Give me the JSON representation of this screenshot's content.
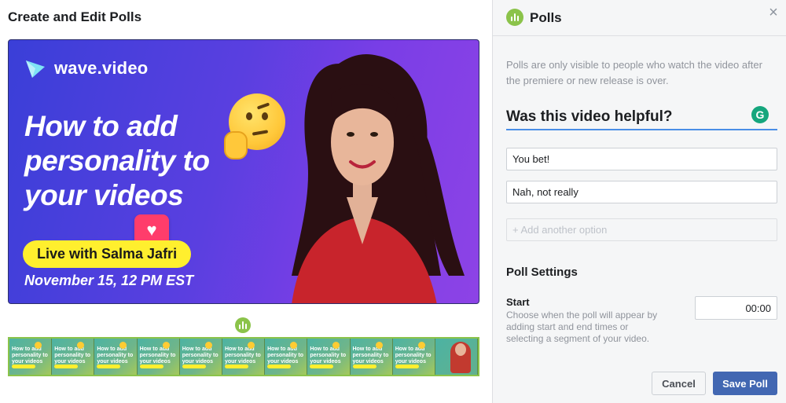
{
  "left": {
    "title": "Create and Edit Polls",
    "video": {
      "logo_text": "wave.video",
      "headline": "How to add personality to your videos",
      "live_text": "Live with Salma Jafri",
      "date_text": "November 15, 12 PM EST"
    },
    "filmstrip": {
      "frame_text": "How to add personality to your videos"
    }
  },
  "panel": {
    "title": "Polls",
    "close_label": "×",
    "info": "Polls are only visible to people who watch the video after the premiere or new release is over.",
    "question_value": "Was this video helpful?",
    "grammarly_label": "G",
    "options": [
      {
        "value": "You bet!"
      },
      {
        "value": "Nah, not really"
      }
    ],
    "add_option_placeholder": "+ Add another option",
    "settings_title": "Poll Settings",
    "start_label": "Start",
    "start_desc": "Choose when the poll will appear by adding start and end times or selecting a segment of your video.",
    "start_time": "00:00",
    "cancel_label": "Cancel",
    "save_label": "Save Poll"
  },
  "colors": {
    "accent_green": "#8bc34a",
    "primary_blue": "#4267b2",
    "focus_blue": "#4a8ee6"
  }
}
